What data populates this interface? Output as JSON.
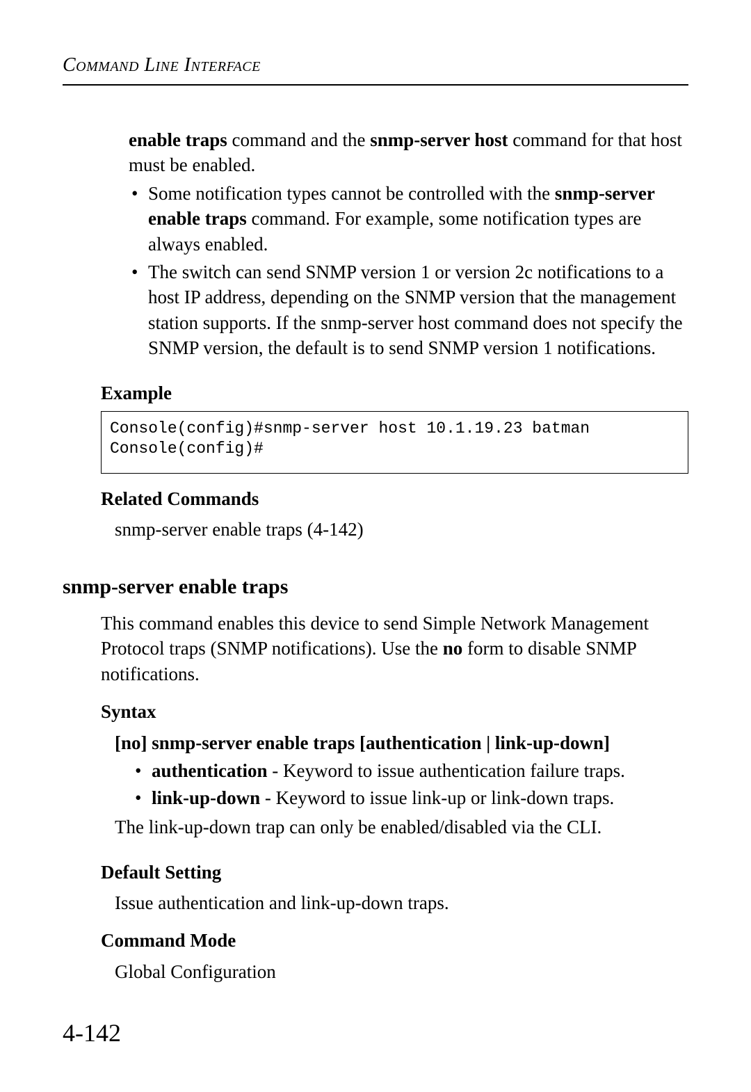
{
  "header": "Command Line Interface",
  "top_paragraph_parts": {
    "pre": "",
    "b1": "enable traps",
    "mid1": " command and the ",
    "b2": "snmp-server host",
    "mid2": " command for that host must be enabled."
  },
  "bullets_top": [
    {
      "pre": "Some notification types cannot be controlled with the ",
      "b": "snmp-server enable traps",
      "post": " command. For example, some notification types are always enabled."
    },
    {
      "pre": "The switch can send SNMP version 1 or version 2c notifications to a host IP address, depending on the SNMP version that the management station supports. If the snmp-server host command does not specify the SNMP version, the default is to send SNMP version 1 notifications.",
      "b": "",
      "post": ""
    }
  ],
  "labels": {
    "example": "Example",
    "related": "Related Commands",
    "syntax": "Syntax",
    "default_setting": "Default Setting",
    "command_mode": "Command Mode"
  },
  "code_example": "Console(config)#snmp-server host 10.1.19.23 batman\nConsole(config)#",
  "related_text": "snmp-server enable traps (4-142)",
  "h2": "snmp-server enable traps",
  "desc_parts": {
    "pre": "This command enables this device to send Simple Network Management Protocol traps (SNMP notifications). Use the ",
    "b": "no",
    "post": " form to disable SNMP notifications."
  },
  "syntax_line": "[no] snmp-server enable traps [authentication | link-up-down]",
  "syntax_bullets": [
    {
      "b": "authentication",
      "post": " - Keyword to issue authentication failure traps."
    },
    {
      "b": "link-up-down",
      "post": " - Keyword to issue link-up or link-down traps."
    }
  ],
  "syntax_note": "The link-up-down trap can only be enabled/disabled via the CLI.",
  "default_setting_text": "Issue authentication and link-up-down traps.",
  "command_mode_text": "Global Configuration",
  "page_number": "4-142"
}
